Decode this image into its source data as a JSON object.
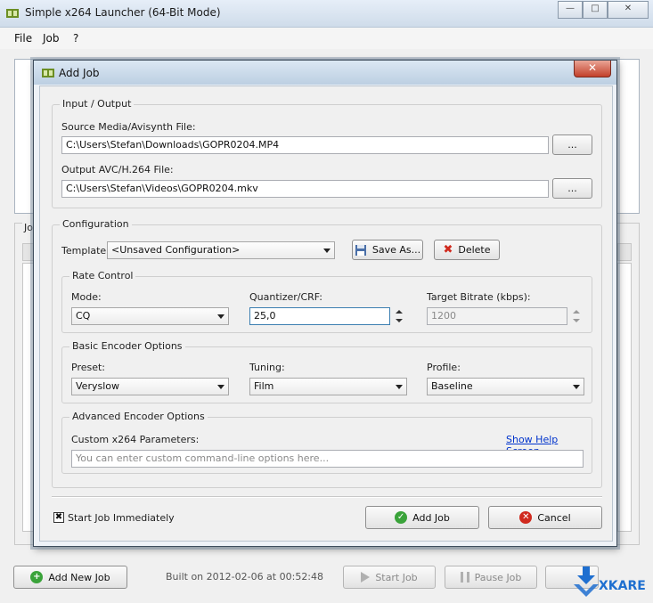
{
  "main_window": {
    "title": "Simple x264 Launcher (64-Bit Mode)",
    "menu": [
      "File",
      "Job",
      "?"
    ],
    "partial_group_label": "Jo",
    "buttons": {
      "add_new_job": "Add New Job",
      "start_job": "Start Job",
      "pause_job": "Pause Job"
    },
    "built_text": "Built on 2012-02-06 at 00:52:48",
    "watermark": "XKARE"
  },
  "dialog": {
    "title": "Add Job",
    "io_group": {
      "title": "Input / Output",
      "source_label": "Source Media/Avisynth File:",
      "source_value": "C:\\Users\\Stefan\\Downloads\\GOPR0204.MP4",
      "output_label": "Output AVC/H.264 File:",
      "output_value": "C:\\Users\\Stefan\\Videos\\GOPR0204.mkv",
      "browse_label": "..."
    },
    "config_group": {
      "title": "Configuration",
      "template_label": "Template:",
      "template_value": "<Unsaved Configuration>",
      "save_as": "Save As...",
      "delete": "Delete",
      "rate_control": {
        "title": "Rate Control",
        "mode_label": "Mode:",
        "mode_value": "CQ",
        "quantizer_label": "Quantizer/CRF:",
        "quantizer_value": "25,0",
        "bitrate_label": "Target Bitrate (kbps):",
        "bitrate_value": "1200"
      },
      "basic": {
        "title": "Basic Encoder Options",
        "preset_label": "Preset:",
        "preset_value": "Veryslow",
        "tuning_label": "Tuning:",
        "tuning_value": "Film",
        "profile_label": "Profile:",
        "profile_value": "Baseline"
      },
      "advanced": {
        "title": "Advanced Encoder Options",
        "custom_label": "Custom x264 Parameters:",
        "help_link": "Show Help Screen",
        "custom_placeholder": "You can enter custom command-line options here..."
      }
    },
    "start_immediately_label": "Start Job Immediately",
    "start_immediately_checked": true,
    "add_job": "Add Job",
    "cancel": "Cancel"
  }
}
